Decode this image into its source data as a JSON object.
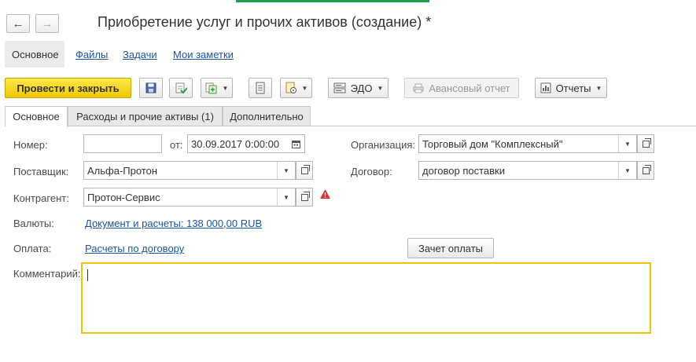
{
  "window": {
    "title": "Приобретение услуг и прочих активов (создание) *",
    "back_icon": "←",
    "forward_icon": "→"
  },
  "subnav": {
    "items": [
      "Основное",
      "Файлы",
      "Задачи",
      "Мои заметки"
    ]
  },
  "toolbar": {
    "post_close": "Провести и закрыть",
    "edo": "ЭДО",
    "advance_report": "Авансовый отчет",
    "reports": "Отчеты"
  },
  "tabs": [
    "Основное",
    "Расходы и прочие активы (1)",
    "Дополнительно"
  ],
  "form": {
    "number_label": "Номер:",
    "number_value": "",
    "date_label": "от:",
    "date_value": "30.09.2017  0:00:00",
    "org_label": "Организация:",
    "org_value": "Торговый дом \"Комплексный\"",
    "supplier_label": "Поставщик:",
    "supplier_value": "Альфа-Протон",
    "contract_label": "Договор:",
    "contract_value": "договор поставки",
    "counterparty_label": "Контрагент:",
    "counterparty_value": "Протон-Сервис",
    "currency_label": "Валюты:",
    "currency_link": "Документ и расчеты: 138 000,00 RUB",
    "payment_label": "Оплата:",
    "payment_link": "Расчеты по договору",
    "offset_button": "Зачет оплаты",
    "comment_label": "Комментарий:",
    "comment_value": ""
  },
  "colors": {
    "primary": "#f5d400",
    "link": "#1a55a5",
    "warning": "#d9342b",
    "focus_border": "#f0c400"
  }
}
